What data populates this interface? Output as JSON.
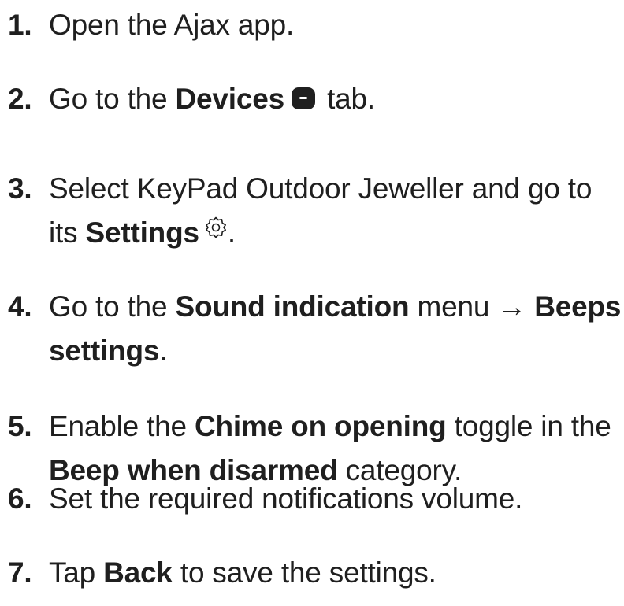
{
  "steps": [
    {
      "num": "1.",
      "text": "Open the Ajax app."
    },
    {
      "num": "2.",
      "pre": "Go to the ",
      "bold": "Devices",
      "post": " tab.",
      "icon": "devices-icon"
    },
    {
      "num": "3.",
      "pre": "Select KeyPad Outdoor Jeweller and go to its ",
      "bold": "Settings",
      "post": ".",
      "icon": "gear-icon"
    },
    {
      "num": "4.",
      "pre": "Go to the ",
      "bold1": "Sound indication",
      "mid": " menu → ",
      "bold2": "Beeps settings",
      "post": "."
    },
    {
      "num": "5.",
      "pre": "Enable the ",
      "bold1": "Chime on opening",
      "mid": " toggle in the ",
      "bold2": "Beep when disarmed",
      "post": " category."
    },
    {
      "num": "6.",
      "text": "Set the required notifications volume."
    },
    {
      "num": "7.",
      "pre": "Tap ",
      "bold": "Back",
      "post": " to save the settings."
    }
  ],
  "colors": {
    "text": "#1f1f1f",
    "icon": "#1f1f1f"
  }
}
